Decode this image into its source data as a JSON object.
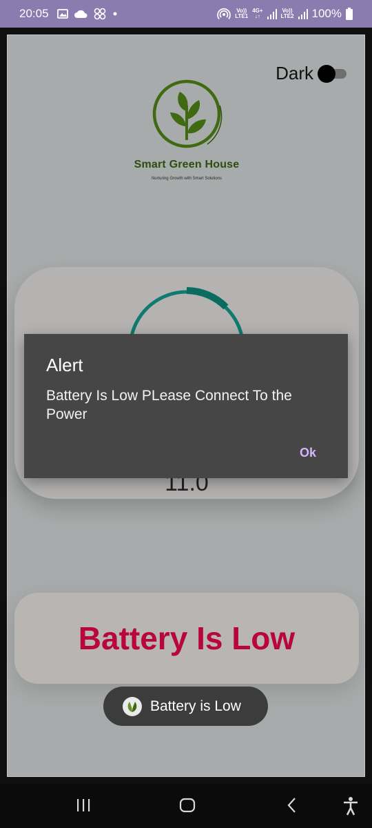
{
  "status_bar": {
    "time": "20:05",
    "left_icons": [
      "image-icon",
      "cloud-icon",
      "ring-apps-icon",
      "dot-icon"
    ],
    "net1_top": "Vo))",
    "net1_bottom": "LTE1",
    "net_4g": "4G+",
    "net2_top": "Vo))",
    "net2_bottom": "LTE2",
    "battery": "100%"
  },
  "app": {
    "dark_label": "Dark",
    "dark_enabled": false,
    "logo": {
      "title": "Smart Green House",
      "subtitle": "Nurturing Growth with Smart Solutions",
      "colors": {
        "primary": "#2c4d0c",
        "leaf": "#3f6a12"
      }
    },
    "gauge": {
      "value_text": "11.0",
      "arc_color": "#0f7a6f",
      "arc_accent": "#0a6b60"
    },
    "battery_card": {
      "text": "Battery Is Low",
      "color": "#b8063c"
    },
    "toast": {
      "text": "Battery is Low"
    }
  },
  "dialog": {
    "title": "Alert",
    "message": "Battery Is Low PLease Connect To the Power",
    "ok_label": "Ok",
    "ok_color": "#d2b6ff"
  },
  "nav_bar": {
    "buttons": [
      "recent-apps-icon",
      "home-icon",
      "back-icon",
      "accessibility-icon"
    ]
  }
}
